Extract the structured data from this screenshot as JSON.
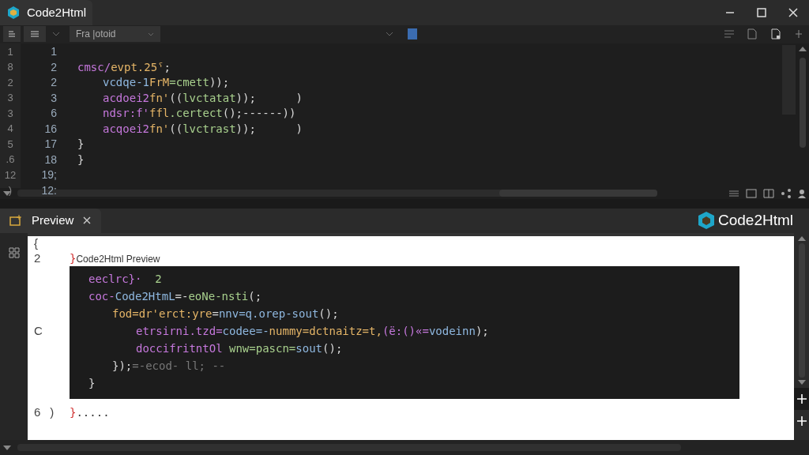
{
  "window": {
    "title": "Code2Html"
  },
  "toolbar": {
    "field": {
      "value": "Fra |otoid"
    }
  },
  "editor": {
    "rows": [
      {
        "outer": "1",
        "inner": "1"
      },
      {
        "outer": "8",
        "inner": "2"
      },
      {
        "outer": "2",
        "inner": "2"
      },
      {
        "outer": "3",
        "inner": "3"
      },
      {
        "outer": "3",
        "inner": "6"
      },
      {
        "outer": "4",
        "inner": "16"
      },
      {
        "outer": "5",
        "inner": "17"
      },
      {
        "outer": ".6",
        "inner": "18"
      },
      {
        "outer": "12",
        "inner": "19;"
      },
      {
        "outer": ")",
        "inner": "12:"
      }
    ],
    "lines": [
      {
        "tokens": [
          {
            "kind": "kw",
            "text": "cmsc/"
          },
          {
            "kind": "str",
            "text": "evpt.25ˤ"
          },
          {
            "kind": "punct",
            "text": ";"
          }
        ],
        "children": [
          {
            "tokens": [
              {
                "kind": "fn",
                "text": "vcdqe-1"
              },
              {
                "kind": "str",
                "text": "FrM"
              },
              {
                "kind": "green",
                "text": "=cmett"
              },
              {
                "kind": "punct",
                "text": "));"
              }
            ]
          },
          {
            "tokens": [
              {
                "kind": "kw",
                "text": "acdoei2"
              },
              {
                "kind": "str",
                "text": "fn'"
              },
              {
                "kind": "punct",
                "text": "(("
              },
              {
                "kind": "green",
                "text": "lvctatat"
              },
              {
                "kind": "punct",
                "text": "));      )"
              }
            ]
          },
          {
            "tokens": [
              {
                "kind": "kw",
                "text": "ndsr:f'"
              },
              {
                "kind": "str",
                "text": "ffl"
              },
              {
                "kind": "green",
                "text": ".certect"
              },
              {
                "kind": "punct",
                "text": "();------))"
              }
            ]
          },
          {
            "tokens": [
              {
                "kind": "kw",
                "text": "acqoei2"
              },
              {
                "kind": "str",
                "text": "fn'"
              },
              {
                "kind": "punct",
                "text": "(("
              },
              {
                "kind": "green",
                "text": "lvctrast"
              },
              {
                "kind": "punct",
                "text": "));      )"
              }
            ]
          }
        ]
      },
      {
        "tokens": [
          {
            "kind": "punct",
            "text": "}"
          }
        ]
      },
      {
        "tokens": [
          {
            "kind": "punct",
            "text": "}"
          }
        ]
      }
    ]
  },
  "preview": {
    "tab": {
      "label": "Preview"
    },
    "brand": "Code2Html",
    "rows": [
      {
        "gutter": [
          "{"
        ]
      },
      {
        "gutter": [
          "2"
        ],
        "tokens": [
          {
            "kind": "red",
            "text": "}"
          },
          {
            "kind": "label",
            "text": "Code2Html Preview"
          }
        ]
      }
    ],
    "block": [
      {
        "tokens": [
          {
            "kind": "kw",
            "text": "eeclrc}·"
          },
          {
            "kind": "green",
            "text": "  2"
          }
        ]
      },
      {
        "tokens": [
          {
            "kind": "kw",
            "text": "coc-"
          },
          {
            "kind": "fn",
            "text": "Code2HtmL"
          },
          {
            "kind": "punct",
            "text": "=-"
          },
          {
            "kind": "green",
            "text": "eoNe-nsti"
          },
          {
            "kind": "punct",
            "text": "(;"
          }
        ],
        "children": [
          {
            "tokens": [
              {
                "kind": "str",
                "text": "fod=dr'erct:yre"
              },
              {
                "kind": "punct",
                "text": "="
              },
              {
                "kind": "fn",
                "text": "nnv=q.orep-sout"
              },
              {
                "kind": "punct",
                "text": "();"
              }
            ],
            "children": [
              {
                "gutter": [
                  "C"
                ],
                "tokens": [
                  {
                    "kind": "kw",
                    "text": "etrsirni.tzd="
                  },
                  {
                    "kind": "fn",
                    "text": "codee=-"
                  },
                  {
                    "kind": "str",
                    "text": "nummy=dctnaitz=t,"
                  },
                  {
                    "kind": "kw",
                    "text": "(ë:()«="
                  },
                  {
                    "kind": "fn",
                    "text": "vodeinn"
                  },
                  {
                    "kind": "punct",
                    "text": ");"
                  }
                ]
              },
              {
                "tokens": [
                  {
                    "kind": "kw",
                    "text": "doccifritntOl "
                  },
                  {
                    "kind": "green",
                    "text": "wnw=pascn="
                  },
                  {
                    "kind": "fn",
                    "text": "sout"
                  },
                  {
                    "kind": "punct",
                    "text": "();"
                  }
                ]
              }
            ]
          },
          {
            "tokens": [
              {
                "kind": "punct",
                "text": "});"
              },
              {
                "kind": "dim",
                "text": "=-ecod- ll; --"
              }
            ]
          }
        ]
      },
      {
        "tokens": [
          {
            "kind": "punct",
            "text": "}"
          }
        ]
      }
    ],
    "after": [
      {
        "gutter": [
          "6",
          ")"
        ],
        "tokens": [
          {
            "kind": "red",
            "text": "}"
          },
          {
            "kind": "dark",
            "text": "....."
          }
        ]
      }
    ]
  }
}
